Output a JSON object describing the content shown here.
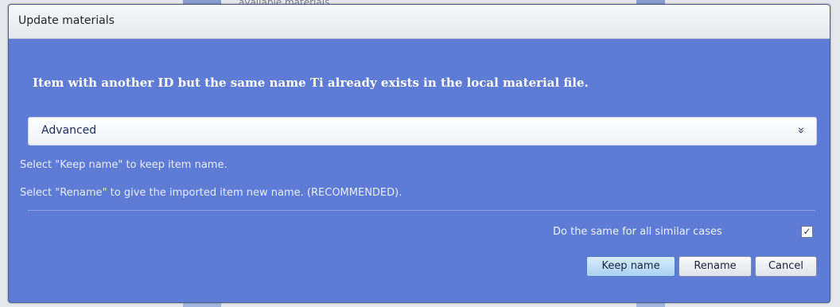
{
  "background": {
    "fragment_text": "available materials"
  },
  "dialog": {
    "title": "Update materials",
    "message": "Item with another ID but the same name Ti already exists in the local material file.",
    "advanced": {
      "label": "Advanced",
      "toggle_glyph": "»",
      "icon": "double-chevron-down-icon"
    },
    "help_lines": [
      "Select \"Keep name\" to keep item name.",
      "Select \"Rename\" to give the imported item new name. (RECOMMENDED)."
    ],
    "same_for_all": {
      "label": "Do the same for all similar cases",
      "checked": true,
      "check_glyph": "✓"
    },
    "buttons": {
      "keep_name": "Keep name",
      "rename": "Rename",
      "cancel": "Cancel"
    }
  },
  "colors": {
    "dialog_body": "#5e7bd6",
    "titlebar": "#eef0f4",
    "primary_button": "#b7daf5"
  }
}
